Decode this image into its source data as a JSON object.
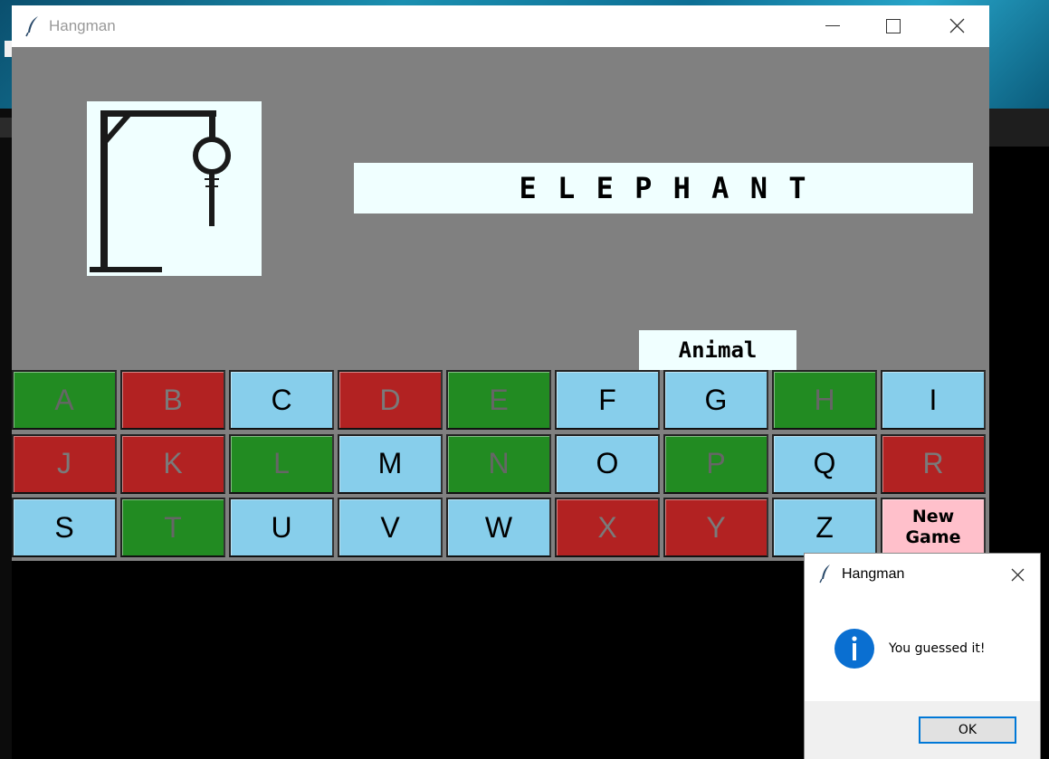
{
  "window": {
    "title": "Hangman",
    "icon": "feather-icon",
    "controls": [
      "minimize-icon",
      "maximize-icon",
      "close-icon"
    ]
  },
  "game": {
    "word": "E L E P H A N T",
    "category": "Animal",
    "wrong_guesses": 0
  },
  "keyboard": {
    "rows": [
      [
        {
          "letter": "A",
          "state": "hit"
        },
        {
          "letter": "B",
          "state": "miss"
        },
        {
          "letter": "C",
          "state": "unused"
        },
        {
          "letter": "D",
          "state": "miss"
        },
        {
          "letter": "E",
          "state": "hit"
        },
        {
          "letter": "F",
          "state": "unused"
        },
        {
          "letter": "G",
          "state": "unused"
        },
        {
          "letter": "H",
          "state": "hit"
        },
        {
          "letter": "I",
          "state": "unused"
        }
      ],
      [
        {
          "letter": "J",
          "state": "miss"
        },
        {
          "letter": "K",
          "state": "miss"
        },
        {
          "letter": "L",
          "state": "hit"
        },
        {
          "letter": "M",
          "state": "unused"
        },
        {
          "letter": "N",
          "state": "hit"
        },
        {
          "letter": "O",
          "state": "unused"
        },
        {
          "letter": "P",
          "state": "hit"
        },
        {
          "letter": "Q",
          "state": "unused"
        },
        {
          "letter": "R",
          "state": "miss"
        }
      ],
      [
        {
          "letter": "S",
          "state": "unused"
        },
        {
          "letter": "T",
          "state": "hit"
        },
        {
          "letter": "U",
          "state": "unused"
        },
        {
          "letter": "V",
          "state": "unused"
        },
        {
          "letter": "W",
          "state": "unused"
        },
        {
          "letter": "X",
          "state": "miss"
        },
        {
          "letter": "Y",
          "state": "miss"
        },
        {
          "letter": "Z",
          "state": "unused"
        }
      ]
    ],
    "new_game_line1": "New",
    "new_game_line2": "Game"
  },
  "dialog": {
    "title": "Hangman",
    "icon": "info-icon",
    "message": "You guessed it!",
    "ok_label": "OK"
  },
  "colors": {
    "hit": "#228b22",
    "miss": "#b22222",
    "unused": "#87ceeb",
    "new_game": "#ffc0cb",
    "board_bg": "#808080",
    "panel_bg": "#f0ffff"
  }
}
